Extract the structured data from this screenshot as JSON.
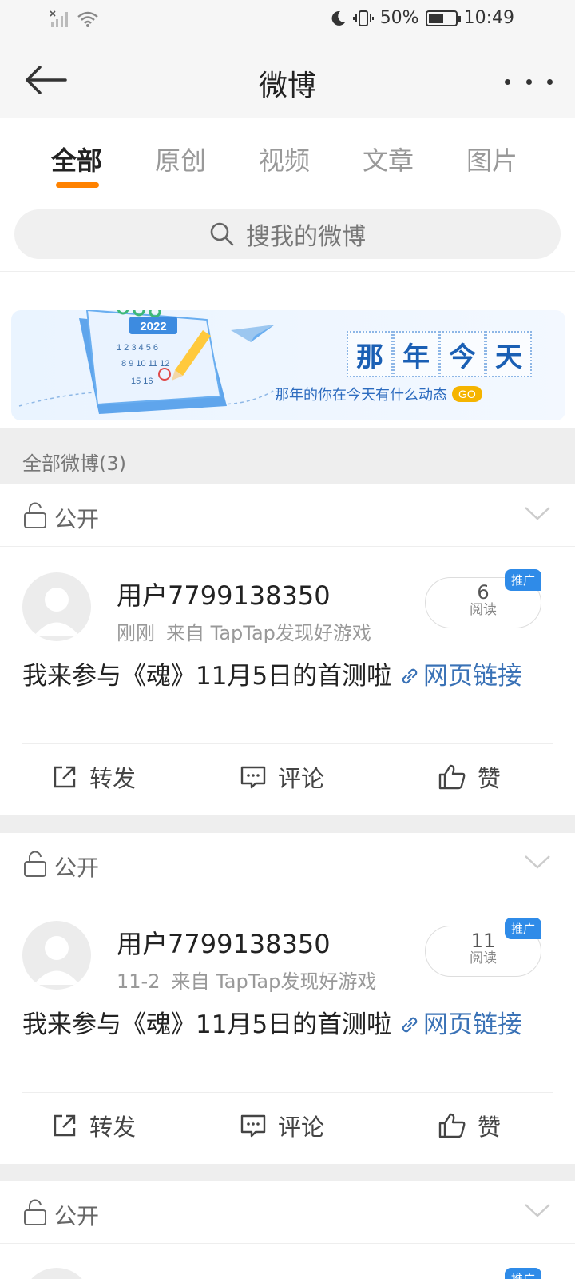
{
  "status_bar": {
    "battery_percent": "50%",
    "time": "10:49",
    "icons": [
      "no-sim-signal-icon",
      "wifi-icon",
      "moon-icon",
      "vibrate-icon",
      "battery-icon"
    ]
  },
  "nav": {
    "title": "微博",
    "back_icon": "back-arrow-icon",
    "more_icon": "more-dots-icon"
  },
  "tabs": [
    {
      "label": "全部",
      "active": true
    },
    {
      "label": "原创",
      "active": false
    },
    {
      "label": "视频",
      "active": false
    },
    {
      "label": "文章",
      "active": false
    },
    {
      "label": "图片",
      "active": false
    }
  ],
  "search": {
    "placeholder": "搜我的微博"
  },
  "banner": {
    "chars": [
      "那",
      "年",
      "今",
      "天"
    ],
    "subtitle": "那年的你在今天有什么动态",
    "go": "GO",
    "calendar_year": "2022"
  },
  "section": {
    "title": "全部微博(3)"
  },
  "posts": [
    {
      "privacy": "公开",
      "username": "用户7799138350",
      "time": "刚刚",
      "source": "来自 TapTap发现好游戏",
      "read_count": "6",
      "read_label": "阅读",
      "promo": "推广",
      "text": "我来参与《魂》11月5日的首测啦 ",
      "link": "网页链接",
      "actions": {
        "repost": "转发",
        "comment": "评论",
        "like": "赞"
      }
    },
    {
      "privacy": "公开",
      "username": "用户7799138350",
      "time": "11-2",
      "source": "来自 TapTap发现好游戏",
      "read_count": "11",
      "read_label": "阅读",
      "promo": "推广",
      "text": "我来参与《魂》11月5日的首测啦 ",
      "link": "网页链接",
      "actions": {
        "repost": "转发",
        "comment": "评论",
        "like": "赞"
      }
    },
    {
      "privacy": "公开",
      "promo": "推广"
    }
  ],
  "colors": {
    "accent_orange": "#ff8200",
    "link_blue": "#3a72b6",
    "promo_blue": "#2f8be8",
    "banner_blue": "#1a5fb4"
  }
}
